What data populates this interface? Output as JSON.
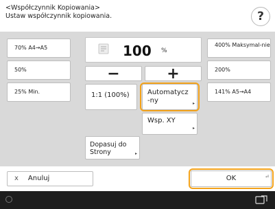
{
  "header": {
    "title": "<Współczynnik Kopiowania>",
    "subtitle": "Ustaw współczynnik kopiowania.",
    "help_label": "?"
  },
  "left_presets": [
    {
      "label": "70% A4→A5"
    },
    {
      "label": "50%"
    },
    {
      "label": "25% Min."
    }
  ],
  "right_presets": [
    {
      "label": "400% Maksymal-nie"
    },
    {
      "label": "200%"
    },
    {
      "label": "141% A5→A4"
    }
  ],
  "zoom": {
    "value": "100",
    "unit": "%"
  },
  "controls": {
    "minus_label": "−",
    "plus_label": "+",
    "one_to_one_label": "1:1 (100%)",
    "auto_label": "Automatycz-ny",
    "xy_label": "Wsp. XY",
    "fit_label": "Dopasuj do Strony"
  },
  "footer": {
    "cancel_label": "Anuluj",
    "cancel_icon": "x",
    "ok_label": "OK"
  },
  "colors": {
    "highlight": "#f3a21a",
    "panel": "#d9d9d9",
    "status_bar": "#1e1e1e"
  }
}
